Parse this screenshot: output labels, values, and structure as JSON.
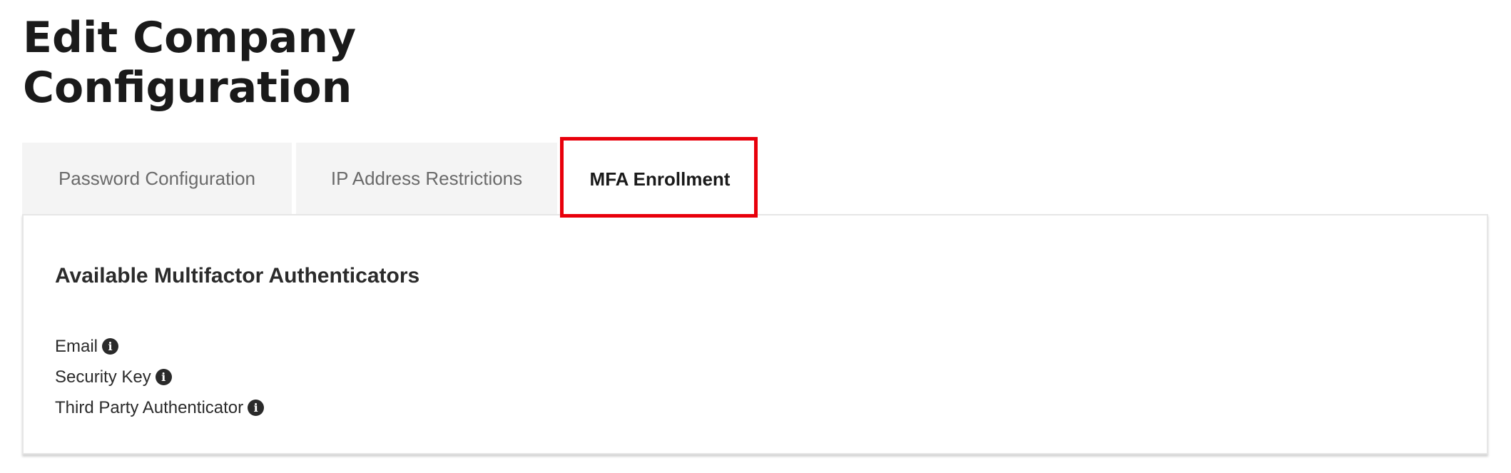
{
  "page": {
    "title": "Edit Company Configuration"
  },
  "tabs": [
    {
      "label": "Password Configuration",
      "active": false
    },
    {
      "label": "IP Address Restrictions",
      "active": false
    },
    {
      "label": "MFA Enrollment",
      "active": true
    }
  ],
  "mfa_panel": {
    "heading": "Available Multifactor Authenticators",
    "authenticators": [
      {
        "label": "Email",
        "icon": "info-icon"
      },
      {
        "label": "Security Key",
        "icon": "info-icon"
      },
      {
        "label": "Third Party Authenticator",
        "icon": "info-icon"
      }
    ]
  },
  "colors": {
    "highlight": "#e8000b",
    "inactive_tab_bg": "#f4f4f4",
    "icon_fill": "#2a2a2a"
  }
}
